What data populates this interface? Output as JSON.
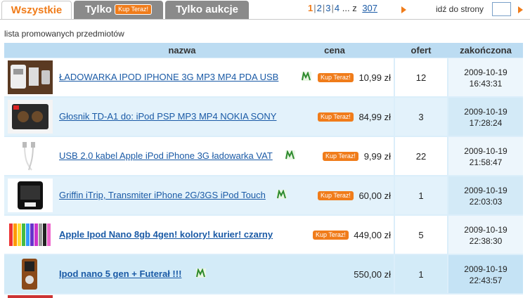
{
  "tabs": [
    {
      "label": "Wszystkie",
      "active": true
    },
    {
      "label": "Tylko",
      "badge": "Kup Teraz!"
    },
    {
      "label": "Tylko aukcje"
    }
  ],
  "pagination": {
    "current": "1",
    "pages": [
      "2",
      "3",
      "4"
    ],
    "ellipsis": "...",
    "of_label": "z",
    "last": "307",
    "goto_label": "idź do strony",
    "goto_value": ""
  },
  "list_label": "lista promowanych przedmiotów",
  "columns": {
    "name": "nazwa",
    "price": "cena",
    "offers": "ofert",
    "ended": "zakończona"
  },
  "kup_teraz_label": "Kup Teraz!",
  "colors": {
    "accent": "#f07c1a",
    "link": "#1a5aa6",
    "header_bg": "#bcdcf2"
  },
  "items": [
    {
      "title": "ŁADOWARKA IPOD IPHONE 3G MP3 MP4 PDA USB",
      "price": "10,99 zł",
      "offers": "12",
      "date": "2009-10-19",
      "time": "16:43:31",
      "kup_teraz": true,
      "mi_icon": true,
      "thumb": "charger-photo"
    },
    {
      "title": "Głosnik TD-A1 do: iPod PSP MP3 MP4 NOKIA SONY",
      "price": "84,99 zł",
      "offers": "3",
      "date": "2009-10-19",
      "time": "17:28:24",
      "kup_teraz": true,
      "mi_icon": false,
      "thumb": "speaker-photo"
    },
    {
      "title": "USB 2.0 kabel Apple iPod iPhone 3G ładowarka VAT",
      "price": "9,99 zł",
      "offers": "22",
      "date": "2009-10-19",
      "time": "21:58:47",
      "kup_teraz": true,
      "mi_icon": true,
      "thumb": "usb-cable-photo"
    },
    {
      "title": "Griffin iTrip, Transmiter iPhone 2G/3GS iPod Touch",
      "price": "60,00 zł",
      "offers": "1",
      "date": "2009-10-19",
      "time": "22:03:03",
      "kup_teraz": true,
      "mi_icon": true,
      "thumb": "transmitter-photo"
    },
    {
      "title": "Apple Ipod Nano 8gb 4gen! kolory! kurier! czarny",
      "price": "449,00 zł",
      "offers": "5",
      "date": "2009-10-19",
      "time": "22:38:30",
      "kup_teraz": true,
      "mi_icon": false,
      "bold": true,
      "thumb": "ipod-nano-colors-photo"
    },
    {
      "title": "Ipod nano 5 gen + Futerał !!!",
      "price": "550,00 zł",
      "offers": "1",
      "date": "2009-10-19",
      "time": "22:43:57",
      "kup_teraz": false,
      "mi_icon": true,
      "bold": true,
      "thumb": "ipod-case-photo"
    }
  ]
}
